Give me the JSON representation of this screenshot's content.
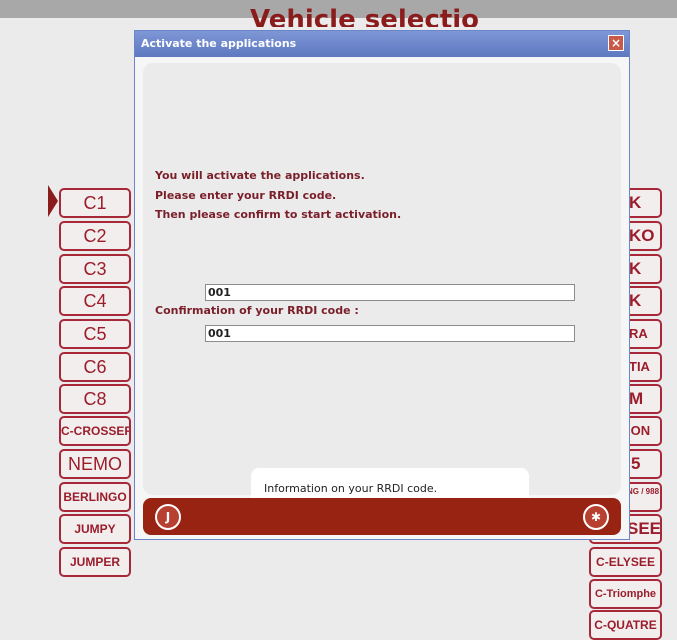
{
  "background": {
    "title": "Vehicle selection",
    "left_models": [
      "C1",
      "C2",
      "C3",
      "C4",
      "C5",
      "C6",
      "C8",
      "C-CROSSER",
      "NEMO",
      "BERLINGO",
      "JUMPY",
      "JUMPER"
    ],
    "right_models": [
      "K",
      "KO",
      "K",
      "K",
      "RA",
      "TIA",
      "M",
      "ION",
      "5",
      "NG / 988",
      "SEE",
      "C-ELYSEE",
      "C-Triomphe",
      "C-QUATRE"
    ]
  },
  "dialog": {
    "title": "Activate the applications",
    "close_glyph": "×",
    "message": [
      "You will activate the applications.",
      "Please enter your RRDI code.",
      "Then please confirm to start activation."
    ],
    "rrdi_value": "001",
    "confirm_label": "Confirmation of your RRDI code :",
    "confirm_value": "001",
    "info_text": "Information on your RRDI code.",
    "footer": {
      "left_icon": "info-icon",
      "right_icon": "confirm-icon"
    }
  },
  "colors": {
    "accent": "#9b1d2c",
    "footer": "#992312",
    "titlebar": "#6f89cc"
  }
}
